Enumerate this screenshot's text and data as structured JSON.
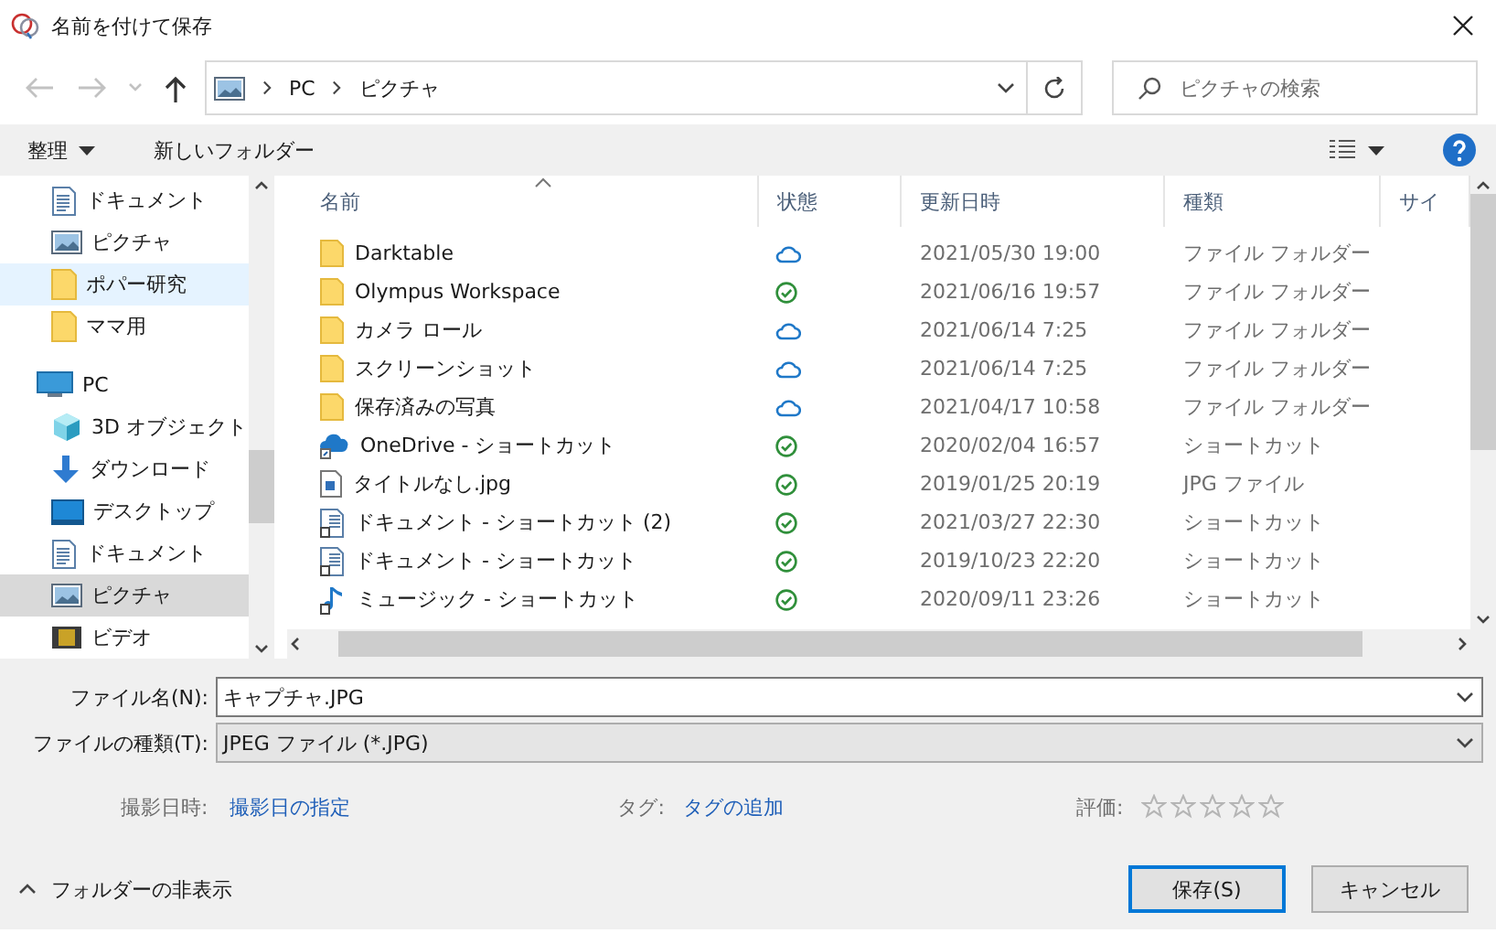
{
  "window": {
    "title": "名前を付けて保存"
  },
  "address": {
    "path": [
      "PC",
      "ピクチャ"
    ]
  },
  "search": {
    "placeholder": "ピクチャの検索"
  },
  "toolbar": {
    "organize": "整理",
    "new_folder": "新しいフォルダー"
  },
  "sidebar": {
    "items": [
      {
        "label": "ドキュメント",
        "kind": "documents",
        "selected": false,
        "hovered": false
      },
      {
        "label": "ピクチャ",
        "kind": "pictures",
        "selected": false,
        "hovered": false
      },
      {
        "label": "ポパー研究",
        "kind": "folder",
        "selected": false,
        "hovered": true
      },
      {
        "label": "ママ用",
        "kind": "folder",
        "selected": false,
        "hovered": false
      },
      {
        "label": "PC",
        "kind": "pc",
        "selected": false,
        "hovered": false,
        "children": [
          {
            "label": "3D オブジェクト",
            "kind": "objects",
            "selected": false,
            "hovered": false
          },
          {
            "label": "ダウンロード",
            "kind": "downloads",
            "selected": false,
            "hovered": false
          },
          {
            "label": "デスクトップ",
            "kind": "desktop",
            "selected": false,
            "hovered": false
          },
          {
            "label": "ドキュメント",
            "kind": "documents",
            "selected": false,
            "hovered": false
          },
          {
            "label": "ピクチャ",
            "kind": "pictures",
            "selected": true,
            "hovered": false
          },
          {
            "label": "ビデオ",
            "kind": "videos",
            "selected": false,
            "hovered": false
          }
        ]
      }
    ]
  },
  "table": {
    "columns": [
      "名前",
      "状態",
      "更新日時",
      "種類",
      "サイ"
    ],
    "rows": [
      {
        "name": "Darktable",
        "kind": "folder",
        "synced": false,
        "date": "2021/05/30 19:00",
        "type": "ファイル フォルダー"
      },
      {
        "name": "Olympus Workspace",
        "kind": "folder",
        "synced": true,
        "date": "2021/06/16 19:57",
        "type": "ファイル フォルダー"
      },
      {
        "name": "カメラ ロール",
        "kind": "folder",
        "synced": false,
        "date": "2021/06/14 7:25",
        "type": "ファイル フォルダー"
      },
      {
        "name": "スクリーンショット",
        "kind": "folder",
        "synced": false,
        "date": "2021/06/14 7:25",
        "type": "ファイル フォルダー"
      },
      {
        "name": "保存済みの写真",
        "kind": "folder",
        "synced": false,
        "date": "2021/04/17 10:58",
        "type": "ファイル フォルダー"
      },
      {
        "name": "OneDrive - ショートカット",
        "kind": "cloud",
        "synced": true,
        "date": "2020/02/04 16:57",
        "type": "ショートカット"
      },
      {
        "name": "タイトルなし.jpg",
        "kind": "image",
        "synced": true,
        "date": "2019/01/25 20:19",
        "type": "JPG ファイル"
      },
      {
        "name": "ドキュメント - ショートカット (2)",
        "kind": "document",
        "synced": true,
        "date": "2021/03/27 22:30",
        "type": "ショートカット"
      },
      {
        "name": "ドキュメント - ショートカット",
        "kind": "document",
        "synced": true,
        "date": "2019/10/23 22:20",
        "type": "ショートカット"
      },
      {
        "name": "ミュージック - ショートカット",
        "kind": "music",
        "synced": true,
        "date": "2020/09/11 23:26",
        "type": "ショートカット"
      }
    ]
  },
  "file_name": {
    "label": "ファイル名(N):",
    "value": "キャプチャ.JPG"
  },
  "file_type": {
    "label": "ファイルの種類(T):",
    "value": "JPEG ファイル (*.JPG)"
  },
  "meta": {
    "date_label": "撮影日時:",
    "date_link": "撮影日の指定",
    "tags_label": "タグ:",
    "tags_link": "タグの追加",
    "rating_label": "評価:",
    "stars": 0
  },
  "hide_folders": "フォルダーの非表示",
  "buttons": [
    {
      "label": "保存(S)",
      "default": true
    },
    {
      "label": "キャンセル",
      "default": false
    }
  ]
}
